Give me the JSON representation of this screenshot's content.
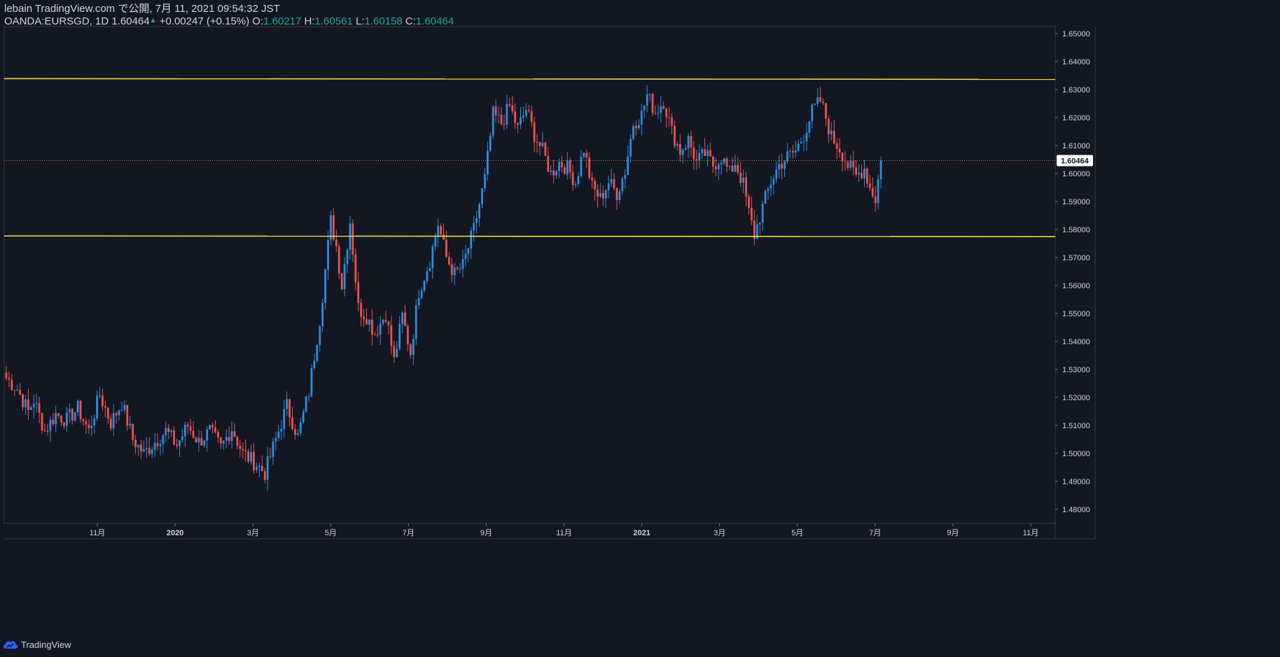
{
  "header": {
    "publisher": "lebain TradingView.com で公開, 7月 11, 2021 09:54:32 JST",
    "symbol": "OANDA:EURSGD, 1D",
    "last": "1.60464",
    "change": "+0.00247 (+0.15%)",
    "o_label": "O:",
    "o_value": "1.60217",
    "h_label": "H:",
    "h_value": "1.60561",
    "l_label": "L:",
    "l_value": "1.60158",
    "c_label": "C:",
    "c_value": "1.60464"
  },
  "footer": {
    "brand": "TradingView",
    "logo_icon": "tradingview-cloud-icon"
  },
  "colors": {
    "background": "#131722",
    "up": "#2f8ee0",
    "down": "#ef5350",
    "horizontal_line": "#f5e642",
    "last_price_label_bg": "#ffffff",
    "axis_text": "#d1d4dc"
  },
  "chart_data": {
    "type": "candlestick",
    "symbol": "OANDA:EURSGD",
    "timeframe": "1D",
    "ylim": [
      1.475,
      1.6525
    ],
    "y_ticks": [
      "1.48000",
      "1.49000",
      "1.50000",
      "1.51000",
      "1.52000",
      "1.53000",
      "1.54000",
      "1.55000",
      "1.56000",
      "1.57000",
      "1.58000",
      "1.59000",
      "1.60000",
      "1.61000",
      "1.62000",
      "1.63000",
      "1.64000",
      "1.65000"
    ],
    "x_ticks": [
      "11月",
      "2020",
      "3月",
      "5月",
      "7月",
      "9月",
      "11月",
      "2021",
      "3月",
      "5月",
      "7月",
      "9月",
      "11月"
    ],
    "horizontal_lines": [
      1.6339,
      1.5777
    ],
    "last_price": "1.60464",
    "last_price_value": 1.60464,
    "close_path": [
      [
        0,
        1.527
      ],
      [
        4,
        1.523
      ],
      [
        8,
        1.515
      ],
      [
        10,
        1.519
      ],
      [
        14,
        1.508
      ],
      [
        18,
        1.514
      ],
      [
        22,
        1.512
      ],
      [
        26,
        1.516
      ],
      [
        30,
        1.508
      ],
      [
        34,
        1.521
      ],
      [
        38,
        1.511
      ],
      [
        42,
        1.518
      ],
      [
        46,
        1.505
      ],
      [
        50,
        1.5
      ],
      [
        54,
        1.504
      ],
      [
        58,
        1.508
      ],
      [
        62,
        1.503
      ],
      [
        66,
        1.51
      ],
      [
        70,
        1.504
      ],
      [
        74,
        1.508
      ],
      [
        78,
        1.502
      ],
      [
        82,
        1.509
      ],
      [
        86,
        1.5
      ],
      [
        90,
        1.497
      ],
      [
        94,
        1.493
      ],
      [
        98,
        1.505
      ],
      [
        102,
        1.517
      ],
      [
        106,
        1.506
      ],
      [
        110,
        1.522
      ],
      [
        114,
        1.548
      ],
      [
        118,
        1.583
      ],
      [
        120,
        1.574
      ],
      [
        122,
        1.56
      ],
      [
        125,
        1.583
      ],
      [
        128,
        1.552
      ],
      [
        131,
        1.549
      ],
      [
        134,
        1.543
      ],
      [
        138,
        1.55
      ],
      [
        141,
        1.533
      ],
      [
        144,
        1.549
      ],
      [
        147,
        1.536
      ],
      [
        150,
        1.558
      ],
      [
        154,
        1.569
      ],
      [
        157,
        1.582
      ],
      [
        160,
        1.57
      ],
      [
        163,
        1.564
      ],
      [
        166,
        1.567
      ],
      [
        170,
        1.58
      ],
      [
        174,
        1.598
      ],
      [
        177,
        1.621
      ],
      [
        180,
        1.618
      ],
      [
        183,
        1.624
      ],
      [
        186,
        1.616
      ],
      [
        189,
        1.623
      ],
      [
        192,
        1.614
      ],
      [
        195,
        1.608
      ],
      [
        198,
        1.6
      ],
      [
        201,
        1.604
      ],
      [
        204,
        1.602
      ],
      [
        207,
        1.597
      ],
      [
        210,
        1.609
      ],
      [
        213,
        1.595
      ],
      [
        216,
        1.591
      ],
      [
        219,
        1.597
      ],
      [
        222,
        1.593
      ],
      [
        225,
        1.601
      ],
      [
        228,
        1.618
      ],
      [
        231,
        1.621
      ],
      [
        233,
        1.628
      ],
      [
        236,
        1.622
      ],
      [
        239,
        1.626
      ],
      [
        242,
        1.615
      ],
      [
        245,
        1.608
      ],
      [
        248,
        1.612
      ],
      [
        251,
        1.604
      ],
      [
        254,
        1.607
      ],
      [
        257,
        1.603
      ],
      [
        260,
        1.606
      ],
      [
        263,
        1.6
      ],
      [
        265,
        1.604
      ],
      [
        268,
        1.596
      ],
      [
        270,
        1.586
      ],
      [
        272,
        1.578
      ],
      [
        275,
        1.588
      ],
      [
        278,
        1.597
      ],
      [
        281,
        1.603
      ],
      [
        284,
        1.606
      ],
      [
        287,
        1.608
      ],
      [
        290,
        1.614
      ],
      [
        293,
        1.622
      ],
      [
        296,
        1.626
      ],
      [
        298,
        1.62
      ],
      [
        300,
        1.613
      ],
      [
        303,
        1.609
      ],
      [
        306,
        1.603
      ],
      [
        309,
        1.599
      ],
      [
        312,
        1.602
      ],
      [
        314,
        1.595
      ],
      [
        316,
        1.591
      ],
      [
        318,
        1.6046
      ]
    ]
  }
}
